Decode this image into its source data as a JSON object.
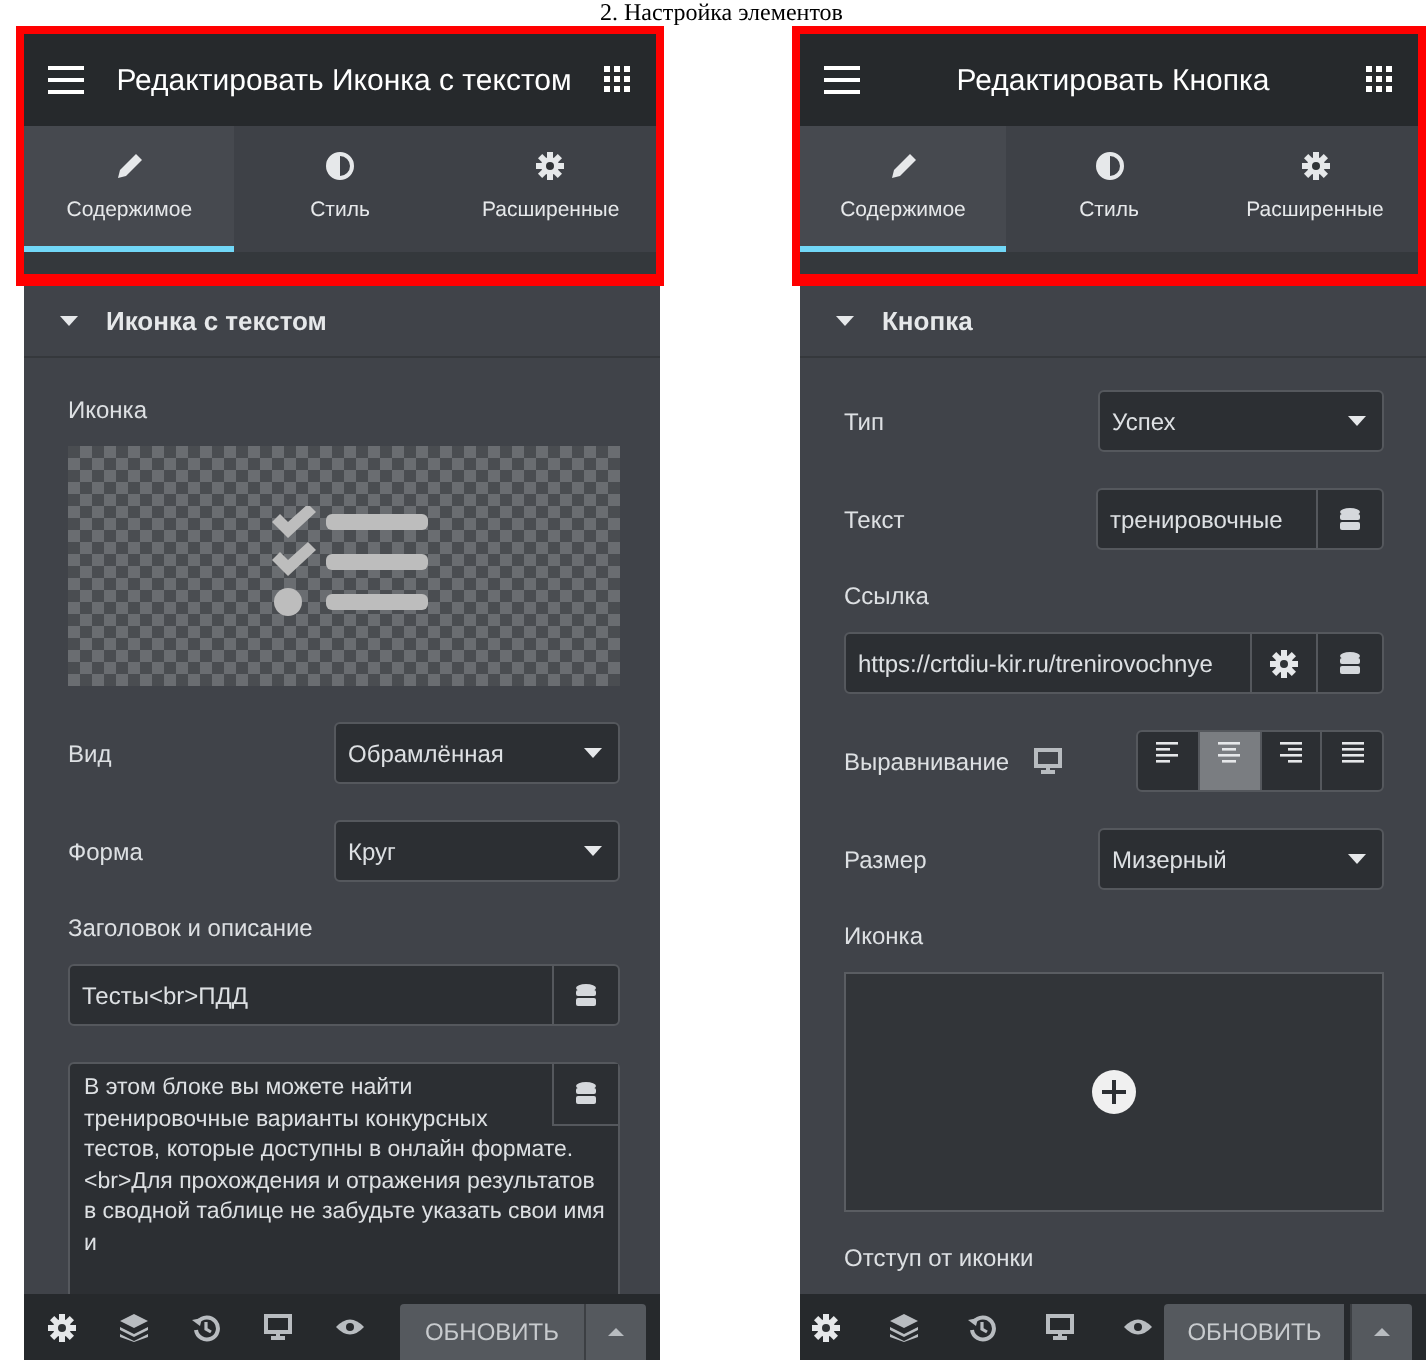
{
  "heading": "2. Настройка элементов",
  "panels": [
    {
      "title": "Редактировать Иконка с текстом",
      "tabs": [
        {
          "label": "Содержимое",
          "selected": true
        },
        {
          "label": "Стиль",
          "selected": false
        },
        {
          "label": "Расширенные",
          "selected": false
        }
      ],
      "section": "Иконка с текстом",
      "controls": [
        {
          "kind": "label",
          "label": "Иконка"
        },
        {
          "kind": "icon_preview"
        },
        {
          "kind": "select",
          "label": "Вид",
          "value": "Обрамлённая"
        },
        {
          "kind": "select",
          "label": "Форма",
          "value": "Круг"
        },
        {
          "kind": "label",
          "label": "Заголовок и описание"
        },
        {
          "kind": "wide_input",
          "value": "Тесты<br>ПДД"
        },
        {
          "kind": "textarea",
          "value": "В этом блоке вы можете найти тренировочные варианты конкурсных тестов, которые доступны в онлайн формате. <br>Для прохождения и отражения результатов в сводной таблице не забудьте указать свои имя и"
        }
      ],
      "footer": {
        "button": "ОБНОВИТЬ"
      }
    },
    {
      "title": "Редактировать Кнопка",
      "tabs": [
        {
          "label": "Содержимое",
          "selected": true
        },
        {
          "label": "Стиль",
          "selected": false
        },
        {
          "label": "Расширенные",
          "selected": false
        }
      ],
      "section": "Кнопка",
      "controls": [
        {
          "kind": "select",
          "label": "Тип",
          "value": "Успех"
        },
        {
          "kind": "input",
          "label": "Текст",
          "value": "тренировочные"
        },
        {
          "kind": "label",
          "label": "Ссылка"
        },
        {
          "kind": "url",
          "value": "https://crtdiu-kir.ru/trenirovochnye"
        },
        {
          "kind": "align",
          "label": "Выравнивание",
          "options": [
            {
              "selected": false
            },
            {
              "selected": true
            },
            {
              "selected": false
            },
            {
              "selected": false
            }
          ]
        },
        {
          "kind": "select",
          "label": "Размер",
          "value": "Мизерный"
        },
        {
          "kind": "label",
          "label": "Иконка"
        },
        {
          "kind": "icon_picker"
        },
        {
          "kind": "label",
          "label": "Отступ от иконки"
        }
      ],
      "footer": {
        "button": "ОБНОВИТЬ"
      }
    }
  ]
}
